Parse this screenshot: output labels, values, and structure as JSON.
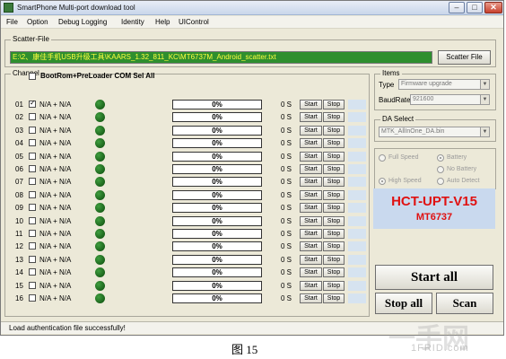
{
  "window": {
    "title": "SmartPhone Multi-port download tool"
  },
  "menu": [
    "File",
    "Option",
    "Debug Logging",
    "Identity",
    "Help",
    "UIControl"
  ],
  "scatter": {
    "label": "Scatter-File",
    "path": "E:\\2、康佳手机USB升级工具\\KAARS_1.32_811_KC\\MT6737M_Android_scatter.txt",
    "button": "Scatter File"
  },
  "channel": {
    "label": "Channel",
    "bootrom_label": "BootRom+PreLoader COM Sel All",
    "rows": [
      {
        "num": "01",
        "port": "N/A + N/A",
        "checked": true,
        "progress": "0%",
        "time": "0 S"
      },
      {
        "num": "02",
        "port": "N/A + N/A",
        "checked": false,
        "progress": "0%",
        "time": "0 S"
      },
      {
        "num": "03",
        "port": "N/A + N/A",
        "checked": false,
        "progress": "0%",
        "time": "0 S"
      },
      {
        "num": "04",
        "port": "N/A + N/A",
        "checked": false,
        "progress": "0%",
        "time": "0 S"
      },
      {
        "num": "05",
        "port": "N/A + N/A",
        "checked": false,
        "progress": "0%",
        "time": "0 S"
      },
      {
        "num": "06",
        "port": "N/A + N/A",
        "checked": false,
        "progress": "0%",
        "time": "0 S"
      },
      {
        "num": "07",
        "port": "N/A + N/A",
        "checked": false,
        "progress": "0%",
        "time": "0 S"
      },
      {
        "num": "08",
        "port": "N/A + N/A",
        "checked": false,
        "progress": "0%",
        "time": "0 S"
      },
      {
        "num": "09",
        "port": "N/A + N/A",
        "checked": false,
        "progress": "0%",
        "time": "0 S"
      },
      {
        "num": "10",
        "port": "N/A + N/A",
        "checked": false,
        "progress": "0%",
        "time": "0 S"
      },
      {
        "num": "11",
        "port": "N/A + N/A",
        "checked": false,
        "progress": "0%",
        "time": "0 S"
      },
      {
        "num": "12",
        "port": "N/A + N/A",
        "checked": false,
        "progress": "0%",
        "time": "0 S"
      },
      {
        "num": "13",
        "port": "N/A + N/A",
        "checked": false,
        "progress": "0%",
        "time": "0 S"
      },
      {
        "num": "14",
        "port": "N/A + N/A",
        "checked": false,
        "progress": "0%",
        "time": "0 S"
      },
      {
        "num": "15",
        "port": "N/A + N/A",
        "checked": false,
        "progress": "0%",
        "time": "0 S"
      },
      {
        "num": "16",
        "port": "N/A + N/A",
        "checked": false,
        "progress": "0%",
        "time": "0 S"
      }
    ],
    "start_label": "Start",
    "stop_label": "Stop"
  },
  "items": {
    "label": "Items",
    "type_label": "Type",
    "type_value": "Firmware upgrade",
    "baud_label": "BaudRate",
    "baud_value": "921600"
  },
  "da": {
    "label": "DA Select",
    "value": "MTK_AllInOne_DA.bin"
  },
  "speed": {
    "full_speed": "Full Speed",
    "high_speed": "High Speed",
    "battery": "Battery",
    "no_battery": "No Battery",
    "auto_detect": "Auto Detect"
  },
  "chip": {
    "title": "HCT-UPT-V15",
    "model": "MT6737",
    "color": "#e01010"
  },
  "actions": {
    "start_all": "Start all",
    "stop_all": "Stop all",
    "scan": "Scan"
  },
  "status": {
    "text": "Load authentication file successfully!"
  },
  "caption": "图 15",
  "watermark": {
    "main": "一手网",
    "sub": "1FRID.com"
  },
  "colors": {
    "scatter_bg": "#2e8f2e",
    "scatter_text": "#ffff40",
    "led": "#1f7a1f"
  }
}
